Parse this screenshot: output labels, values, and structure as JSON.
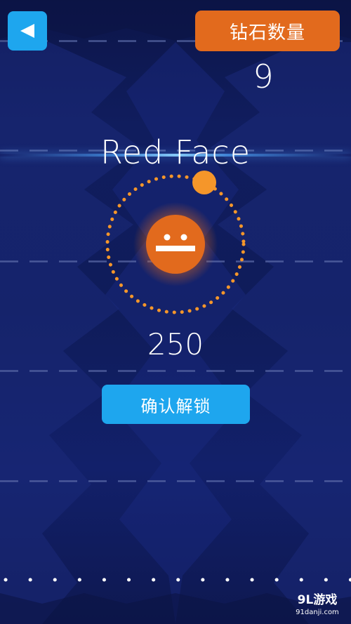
{
  "header": {
    "back_icon": "back-triangle-icon",
    "diamond_label": "钻石数量",
    "diamond_count": "9"
  },
  "character": {
    "name": "Red Face",
    "price": "250",
    "face_icon": "red-face-character-icon"
  },
  "actions": {
    "unlock_label": "确认解锁"
  },
  "watermark": {
    "logo": "9L游戏",
    "url": "91danji.com"
  },
  "colors": {
    "accent_blue": "#1ea6ee",
    "accent_orange": "#e26a1d",
    "orbit_orange": "#f5962a",
    "background": "#0f1a52"
  }
}
